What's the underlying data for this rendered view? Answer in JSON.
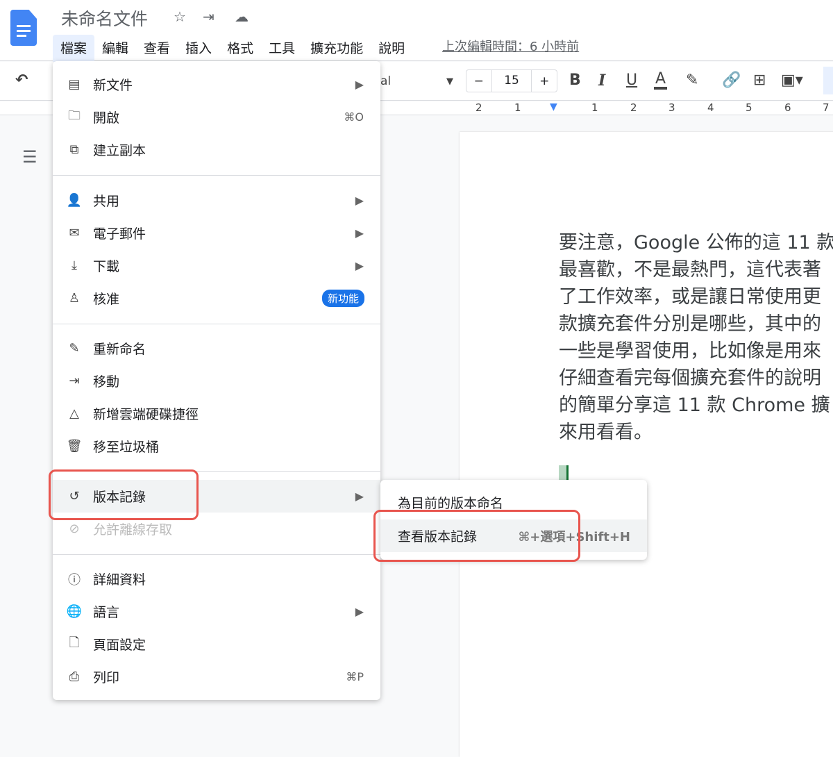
{
  "app": {
    "title": "未命名文件",
    "last_edit": "上次編輯時間：6 小時前",
    "icons": [
      "star-icon",
      "move-folder-icon",
      "cloud-saved-icon"
    ]
  },
  "menubar": [
    "檔案",
    "編輯",
    "查看",
    "插入",
    "格式",
    "工具",
    "擴充功能",
    "說明"
  ],
  "toolbar": {
    "font": "al",
    "font_size": "15",
    "minus": "−",
    "plus": "+",
    "bold": "B",
    "italic": "I",
    "underline": "U",
    "text_color": "A"
  },
  "ruler": [
    "2",
    "1",
    "1",
    "2",
    "3",
    "4",
    "5",
    "6",
    "7"
  ],
  "file_menu": [
    {
      "icon": "▤",
      "label": "新文件",
      "right": "▶"
    },
    {
      "icon": "🗀",
      "label": "開啟",
      "right": "⌘O"
    },
    {
      "icon": "⧉",
      "label": "建立副本",
      "right": ""
    },
    {
      "icon": "👤",
      "label": "共用",
      "right": "▶"
    },
    {
      "icon": "✉",
      "label": "電子郵件",
      "right": "▶"
    },
    {
      "icon": "⤓",
      "label": "下載",
      "right": "▶"
    },
    {
      "icon": "♙",
      "label": "核准",
      "badge": "新功能"
    },
    {
      "icon": "✎",
      "label": "重新命名",
      "right": ""
    },
    {
      "icon": "⇥",
      "label": "移動",
      "right": ""
    },
    {
      "icon": "△",
      "label": "新增雲端硬碟捷徑",
      "right": ""
    },
    {
      "icon": "🗑",
      "label": "移至垃圾桶",
      "right": ""
    },
    {
      "icon": "↺",
      "label": "版本記錄",
      "right": "▶"
    },
    {
      "icon": "⊘",
      "label": "允許離線存取",
      "right": ""
    },
    {
      "icon": "ⓘ",
      "label": "詳細資料",
      "right": ""
    },
    {
      "icon": "🌐",
      "label": "語言",
      "right": "▶"
    },
    {
      "icon": "🗋",
      "label": "頁面設定",
      "right": ""
    },
    {
      "icon": "⎙",
      "label": "列印",
      "right": "⌘P"
    }
  ],
  "submenu": [
    {
      "label": "為目前的版本命名",
      "shortcut": ""
    },
    {
      "label": "查看版本記錄",
      "shortcut": "⌘+選項+Shift+H"
    }
  ],
  "document": {
    "lines": [
      "要注意，Google 公佈的這 11 款",
      "最喜歡，不是最熱門，這代表著",
      "了工作效率，或是讓日常使用更",
      "款擴充套件分別是哪些，其中的",
      "一些是學習使用，比如像是用來",
      "仔細查看完每個擴充套件的說明",
      "的簡單分享這 11 款 Chrome 擴",
      "來用看看。"
    ]
  },
  "colors": {
    "accent": "#1a73e8",
    "highlight": "#e8554e"
  }
}
